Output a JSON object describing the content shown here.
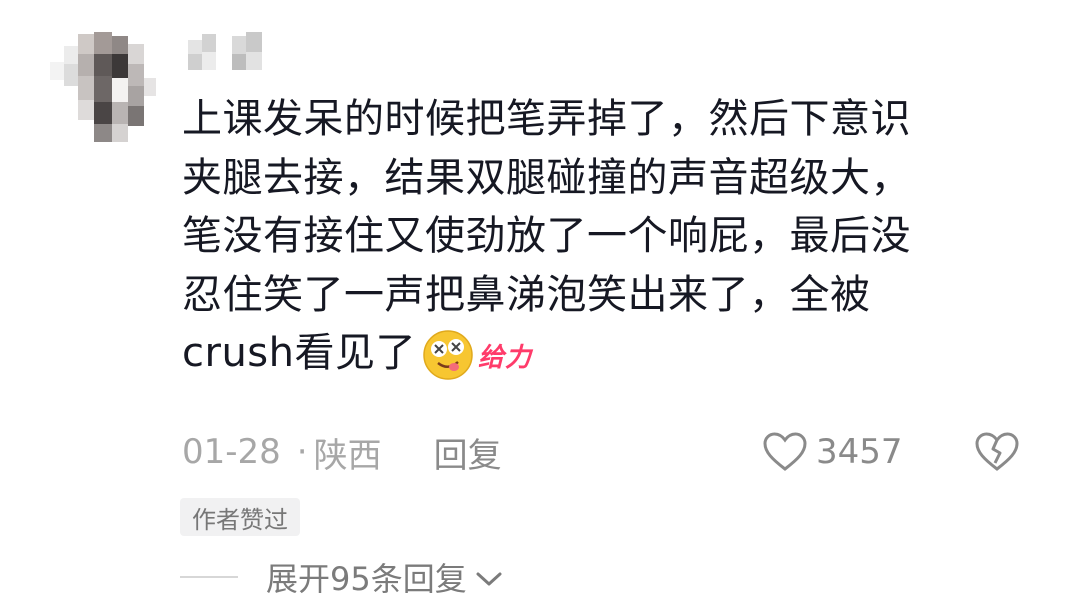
{
  "comment": {
    "lines": [
      "上课发呆的时候把笔弄掉了，然后下意识",
      "夹腿去接，结果双腿碰撞的声音超级大，",
      "笔没有接住又使劲放了一个响屁，最后没",
      "忍住笑了一声把鼻涕泡笑出来了，全被"
    ],
    "last_line": "crush看见了",
    "sticker_text": "给力",
    "sticker_icon": "dizzy-face-emoji"
  },
  "meta": {
    "date": "01-28",
    "separator": "·",
    "location": "陕西",
    "reply_label": "回复",
    "like_count": "3457",
    "like_icon": "heart-outline-icon",
    "dislike_icon": "broken-heart-icon"
  },
  "badge": {
    "label": "作者赞过"
  },
  "expand": {
    "label": "展开95条回复",
    "icon": "chevron-down-icon"
  },
  "colors": {
    "text": "#161823",
    "meta": "#a7a7a7",
    "sticker": "#ff3b6a",
    "badge_bg": "#f1f1f2"
  }
}
